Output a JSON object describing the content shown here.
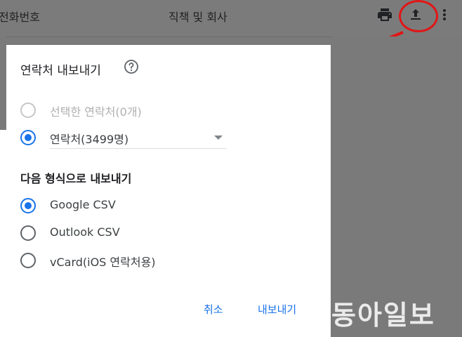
{
  "header": {
    "col_phone": "전화번호",
    "col_job": "직책 및 회사",
    "icons": [
      "print-icon",
      "export-icon",
      "more-vert-icon"
    ]
  },
  "dialog": {
    "title": "연락처 내보내기",
    "help_icon": "help-circle-icon",
    "scope_options": [
      {
        "label": "선택한 연락처(0개)",
        "state": "disabled"
      },
      {
        "label": "연락처(3499명)",
        "state": "checked"
      }
    ],
    "format_title": "다음 형식으로 내보내기",
    "format_options": [
      {
        "label": "Google CSV",
        "state": "checked"
      },
      {
        "label": "Outlook CSV",
        "state": "unchecked"
      },
      {
        "label": "vCard(iOS 연락처용)",
        "state": "unchecked"
      }
    ],
    "cancel_label": "취소",
    "export_label": "내보내기"
  },
  "annotation": {
    "color": "#e01616"
  },
  "watermark": "동아일보",
  "colors": {
    "accent": "#1a73e8",
    "overlay": "#7a7a7a"
  }
}
